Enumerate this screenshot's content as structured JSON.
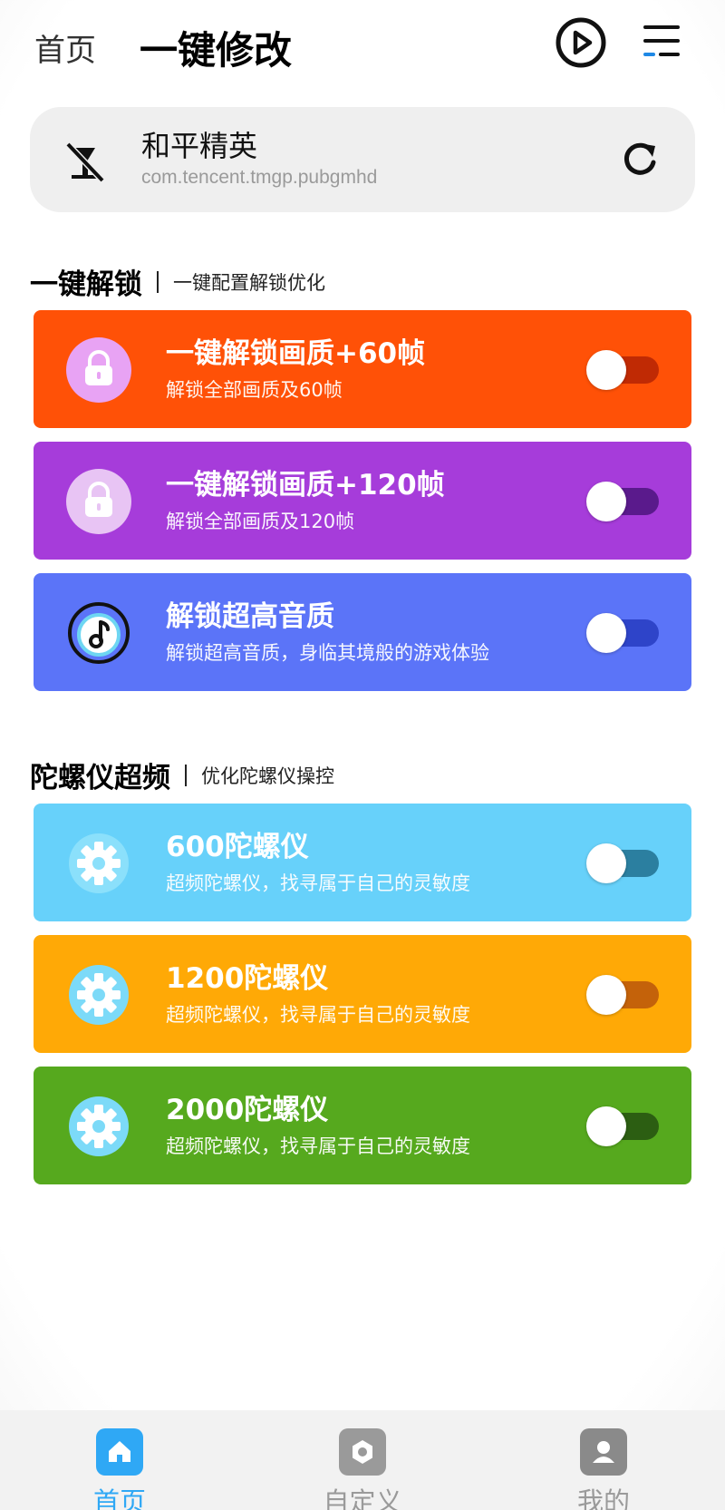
{
  "header": {
    "home_label": "首页",
    "title": "一键修改",
    "play_icon": "play-circle-icon",
    "menu_icon": "menu-icon"
  },
  "app": {
    "name": "和平精英",
    "package": "com.tencent.tmgp.pubgmhd",
    "status_icon": "no-signal-icon",
    "refresh_icon": "refresh-icon"
  },
  "sections": [
    {
      "title": "一键解锁",
      "subtitle": "一键配置解锁优化",
      "items": [
        {
          "title": "一键解锁画质+60帧",
          "subtitle": "解锁全部画质及60帧",
          "icon": "lock-icon",
          "color": "#FF5107",
          "track_color": "#C02A04",
          "enabled": false
        },
        {
          "title": "一键解锁画质+120帧",
          "subtitle": "解锁全部画质及120帧",
          "icon": "lock-icon",
          "color": "#A63CDA",
          "track_color": "#5A1A8C",
          "enabled": false
        },
        {
          "title": "解锁超高音质",
          "subtitle": "解锁超高音质，身临其境般的游戏体验",
          "icon": "music-note-icon",
          "color": "#5B74F8",
          "track_color": "#2E44C9",
          "enabled": false
        }
      ]
    },
    {
      "title": "陀螺仪超频",
      "subtitle": "优化陀螺仪操控",
      "items": [
        {
          "title": "600陀螺仪",
          "subtitle": "超频陀螺仪，找寻属于自己的灵敏度",
          "icon": "gear-icon",
          "color": "#67D1FA",
          "track_color": "#2B7FA0",
          "enabled": false
        },
        {
          "title": "1200陀螺仪",
          "subtitle": "超频陀螺仪，找寻属于自己的灵敏度",
          "icon": "gear-icon",
          "color": "#FFA906",
          "track_color": "#C4620A",
          "enabled": false
        },
        {
          "title": "2000陀螺仪",
          "subtitle": "超频陀螺仪，找寻属于自己的灵敏度",
          "icon": "gear-icon",
          "color": "#56A91E",
          "track_color": "#2C5E12",
          "enabled": false
        }
      ]
    }
  ],
  "tabs": [
    {
      "label": "首页",
      "icon": "home-icon",
      "active": true
    },
    {
      "label": "自定义",
      "icon": "hexagon-icon",
      "active": false
    },
    {
      "label": "我的",
      "icon": "user-icon",
      "active": false
    }
  ],
  "colors": {
    "tab_active": "#2FA8F5",
    "tab_inactive": "#9a9a9a"
  }
}
